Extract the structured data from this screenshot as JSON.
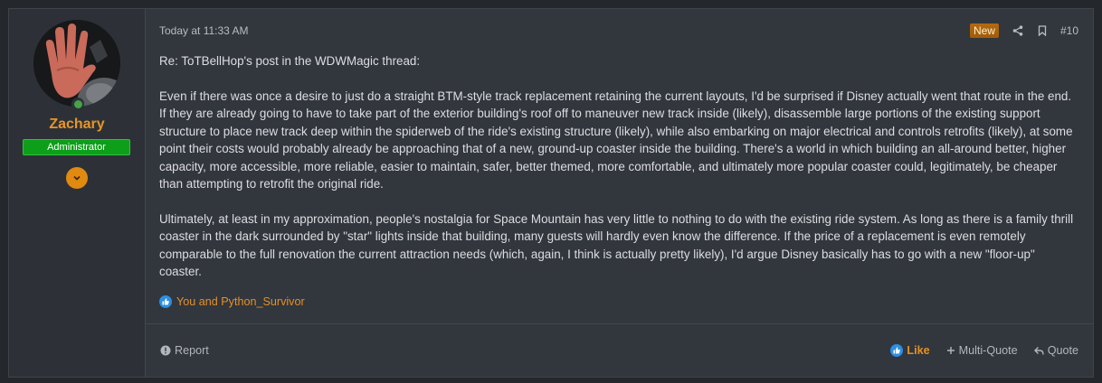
{
  "user": {
    "name": "Zachary",
    "role": "Administrator",
    "online": true,
    "avatar_icon": "raised-hand-avatar"
  },
  "post": {
    "timestamp": "Today at 11:33 AM",
    "badge": "New",
    "number": "#10",
    "paragraphs": [
      "Re: ToTBellHop's post in the WDWMagic thread:",
      "Even if there was once a desire to just do a straight BTM-style track replacement retaining the current layouts, I'd be surprised if Disney actually went that route in the end. If they are already going to have to take part of the exterior building's roof off to maneuver new track inside (likely), disassemble large portions of the existing support structure to place new track deep within the spiderweb of the ride's existing structure (likely), while also embarking on major electrical and controls retrofits (likely), at some point their costs would probably already be approaching that of a new, ground-up coaster inside the building. There's a world in which building an all-around better, higher capacity, more accessible, more reliable, easier to maintain, safer, better themed, more comfortable, and ultimately more popular coaster could, legitimately, be cheaper than attempting to retrofit the original ride.",
      "Ultimately, at least in my approximation, people's nostalgia for Space Mountain has very little to nothing to do with the existing ride system. As long as there is a family thrill coaster in the dark surrounded by \"star\" lights inside that building, many guests will hardly even know the difference. If the price of a replacement is even remotely comparable to the full renovation the current attraction needs (which, again, I think is actually pretty likely), I'd argue Disney basically has to go with a new \"floor-up\" coaster."
    ],
    "reactions": "You and Python_Survivor"
  },
  "footer": {
    "report": "Report",
    "like": "Like",
    "multi_quote": "Multi-Quote",
    "quote": "Quote"
  },
  "colors": {
    "accent": "#e39127",
    "role_badge": "#0d9e1a",
    "like_icon": "#2d8fe0"
  }
}
